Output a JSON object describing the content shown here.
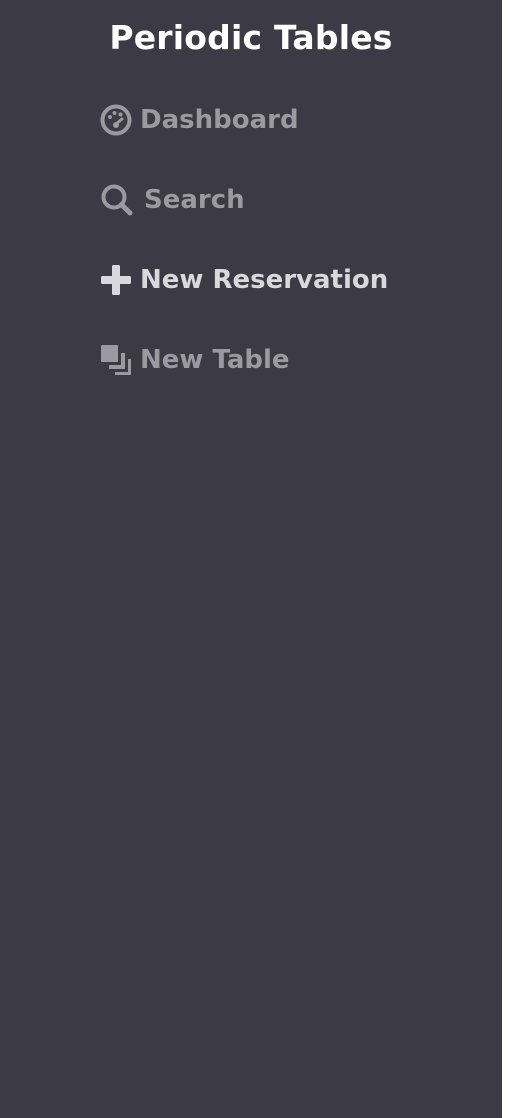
{
  "sidebar": {
    "brand": "Periodic Tables",
    "items": [
      {
        "label": "Dashboard",
        "icon": "dashboard-gauge-icon",
        "active": false
      },
      {
        "label": "Search",
        "icon": "search-icon",
        "active": false
      },
      {
        "label": "New Reservation",
        "icon": "plus-icon",
        "active": true
      },
      {
        "label": "New Table",
        "icon": "stacked-squares-icon",
        "active": false
      }
    ]
  },
  "colors": {
    "sidebar_bg": "#3b3a45",
    "brand_text": "#ffffff",
    "nav_text": "#9a9aa0",
    "nav_text_active": "#d9d9dd",
    "page_bg": "#ffffff"
  }
}
